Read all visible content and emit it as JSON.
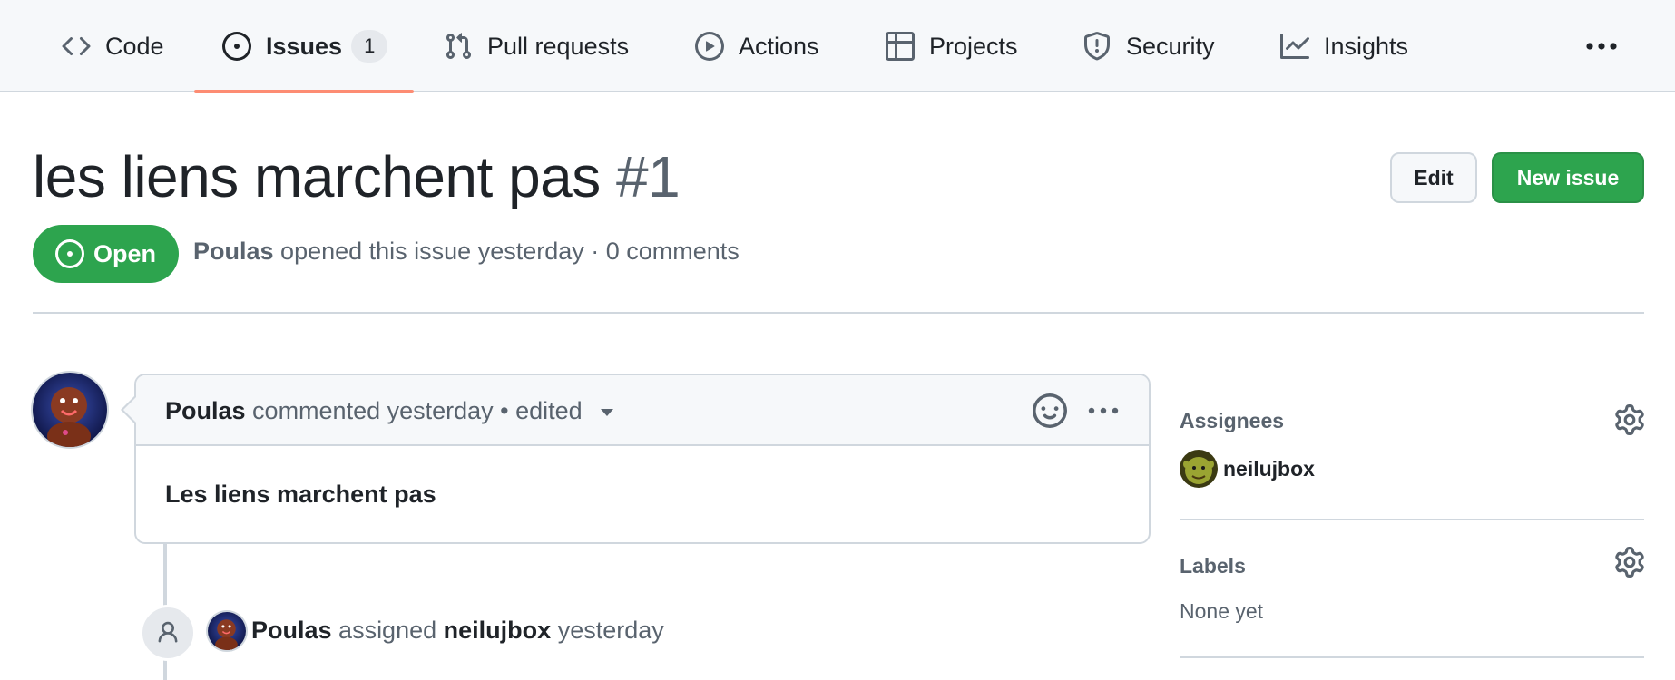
{
  "nav": {
    "tabs": [
      {
        "label": "Code",
        "icon": "code-icon"
      },
      {
        "label": "Issues",
        "icon": "issue-opened-icon",
        "count": "1",
        "selected": true
      },
      {
        "label": "Pull requests",
        "icon": "git-pull-request-icon"
      },
      {
        "label": "Actions",
        "icon": "play-icon"
      },
      {
        "label": "Projects",
        "icon": "table-icon"
      },
      {
        "label": "Security",
        "icon": "shield-icon"
      },
      {
        "label": "Insights",
        "icon": "graph-icon"
      }
    ],
    "more_icon": "kebab-horizontal-icon"
  },
  "issue": {
    "title": "les liens marchent pas",
    "number": "#1",
    "state": "Open",
    "author": "Poulas",
    "meta_text": "opened this issue yesterday · 0 comments"
  },
  "actions": {
    "edit_label": "Edit",
    "new_issue_label": "New issue"
  },
  "comment": {
    "author": "Poulas",
    "header_text": "commented yesterday • edited",
    "body": "Les liens marchent pas"
  },
  "event": {
    "actor": "Poulas",
    "verb": "assigned",
    "target": "neilujbox",
    "time": "yesterday"
  },
  "sidebar": {
    "assignees_heading": "Assignees",
    "assignee": "neilujbox",
    "labels_heading": "Labels",
    "labels_empty": "None yet"
  },
  "colors": {
    "accent_green": "#2da44e",
    "tab_underline": "#fd8c73",
    "muted_text": "#59636e",
    "border": "#d0d7de"
  }
}
